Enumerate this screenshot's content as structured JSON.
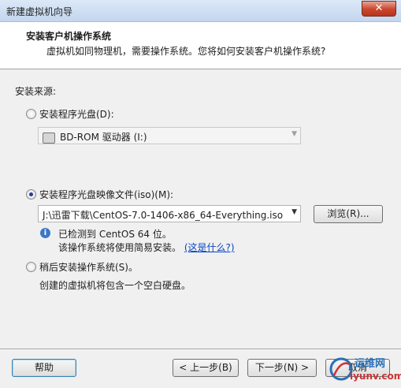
{
  "window": {
    "title": "新建虚拟机向导",
    "close_glyph": "✕"
  },
  "header": {
    "title": "安装客户机操作系统",
    "subtitle": "虚拟机如同物理机，需要操作系统。您将如何安装客户机操作系统?"
  },
  "source": {
    "label": "安装来源:",
    "options": [
      {
        "label": "安装程序光盘(D):",
        "selected": false
      },
      {
        "label": "安装程序光盘映像文件(iso)(M):",
        "selected": true
      },
      {
        "label": "稍后安装操作系统(S)。",
        "selected": false
      }
    ],
    "disc_drive": "BD-ROM 驱动器 (I:)",
    "iso_path": "J:\\迅雷下载\\CentOS-7.0-1406-x86_64-Everything.iso",
    "browse_label": "浏览(R)...",
    "detected_line1": "已检测到 CentOS 64 位。",
    "detected_line2": "该操作系统将使用简易安装。",
    "what_is_this": "(这是什么?)",
    "later_desc": "创建的虚拟机将包含一个空白硬盘。"
  },
  "footer": {
    "help_label": "帮助",
    "back_label": "< 上一步(B)",
    "next_label": "下一步(N) >",
    "cancel_label": "取消"
  },
  "watermark": {
    "text": "运维网",
    "sub": "iyunv.com"
  }
}
